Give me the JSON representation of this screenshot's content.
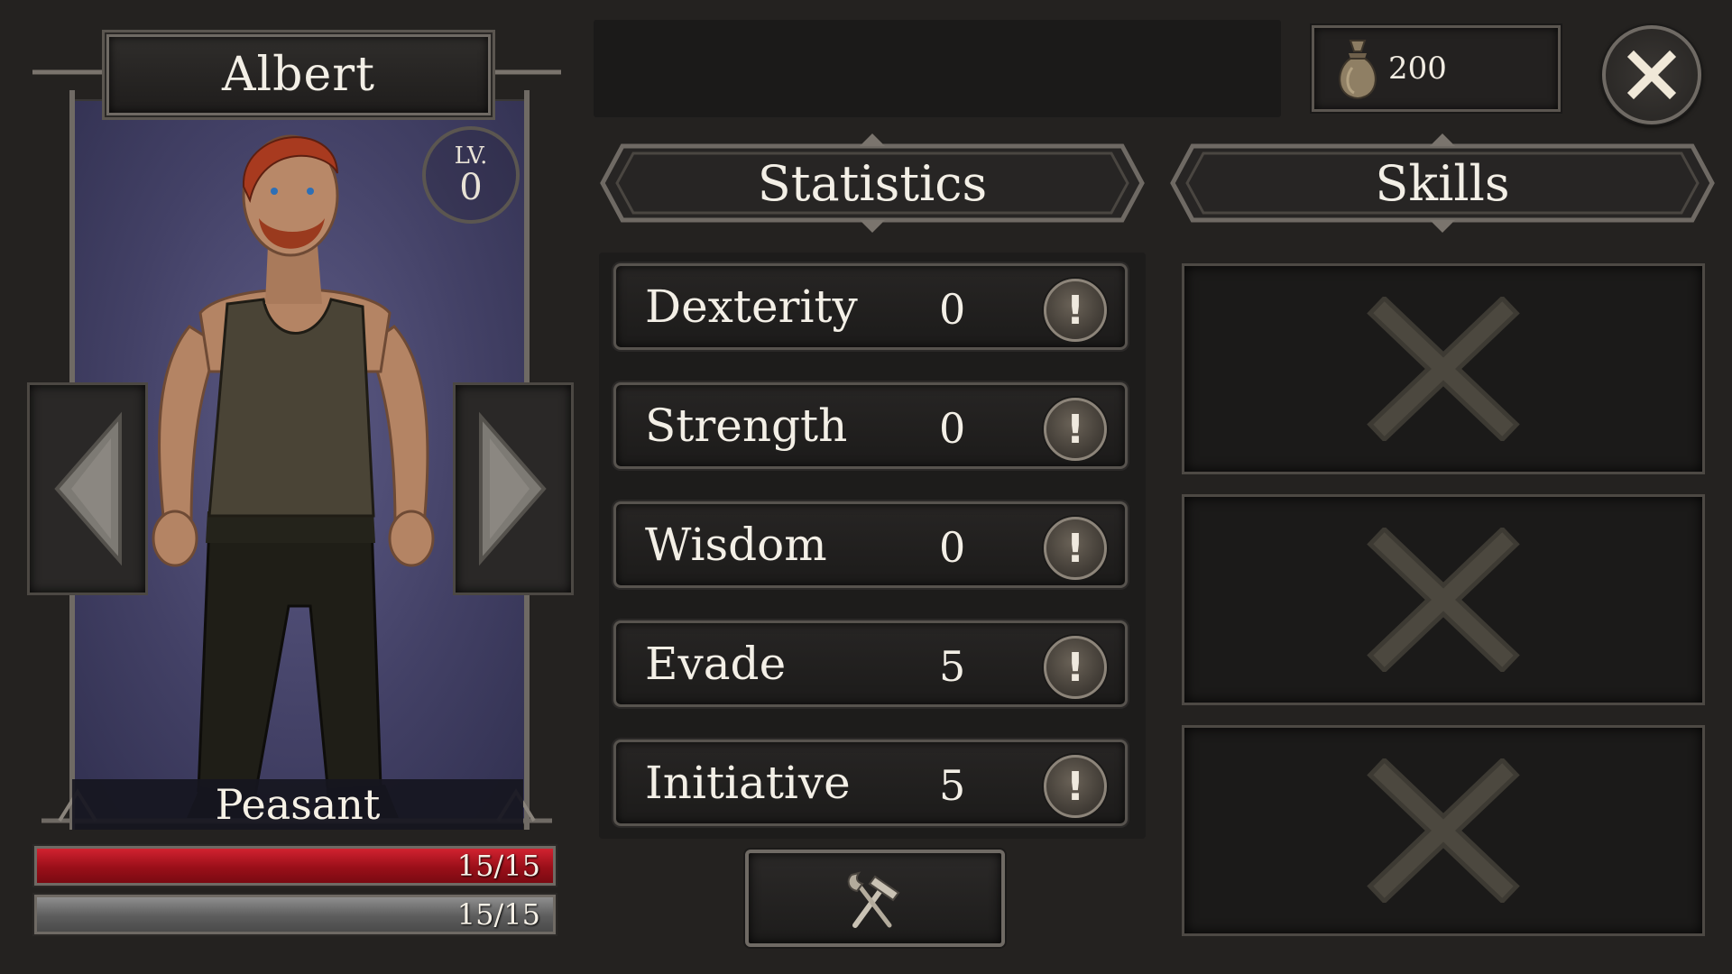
{
  "character": {
    "name": "Albert",
    "level_label": "LV.",
    "level_value": "0",
    "class_name": "Peasant",
    "hp_text": "15/15",
    "hp_fraction": 1.0,
    "xp_text": "15/15",
    "xp_fraction": 1.0
  },
  "gold": {
    "amount": "200",
    "icon": "money-bag-icon"
  },
  "close": {
    "icon": "close-icon"
  },
  "statistics": {
    "title": "Statistics",
    "rows": [
      {
        "name": "Dexterity",
        "value": "0"
      },
      {
        "name": "Strength",
        "value": "0"
      },
      {
        "name": "Wisdom",
        "value": "0"
      },
      {
        "name": "Evade",
        "value": "5"
      },
      {
        "name": "Initiative",
        "value": "5"
      }
    ],
    "info_symbol": "!"
  },
  "skills": {
    "title": "Skills",
    "slots": [
      {
        "state": "empty"
      },
      {
        "state": "empty"
      },
      {
        "state": "empty"
      }
    ]
  },
  "craft_button": {
    "icon": "hammer-tools-icon"
  },
  "colors": {
    "hp": "#c01a26",
    "xp": "#7a7a7a",
    "frame": "#6f6a64",
    "background": "#242220"
  }
}
